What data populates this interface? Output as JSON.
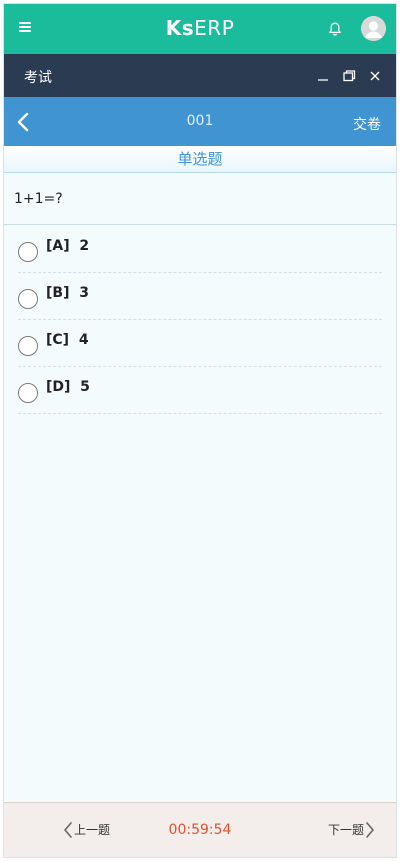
{
  "app": {
    "brand_prefix": "Ks",
    "brand_suffix": "ERP",
    "menu_icon": "hamburger-icon",
    "bell_icon": "bell-icon",
    "avatar_icon": "user-avatar-icon",
    "accent_color": "#1bbc9b"
  },
  "window": {
    "title": "考试",
    "controls": [
      "minimize-icon",
      "restore-icon",
      "close-icon"
    ],
    "bar_color": "#2b3c52"
  },
  "question_header": {
    "number": "001",
    "submit_label": "交卷",
    "back_icon": "chevron-left-icon",
    "bar_color": "#3f94d1"
  },
  "question": {
    "type": "单选题",
    "text": "1+1=?",
    "options": [
      {
        "letter": "[A]",
        "text": "2"
      },
      {
        "letter": "[B]",
        "text": "3"
      },
      {
        "letter": "[C]",
        "text": "4"
      },
      {
        "letter": "[D]",
        "text": "5"
      }
    ]
  },
  "footer": {
    "prev_label": "上一题",
    "next_label": "下一题",
    "timer": "00:59:54",
    "timer_color": "#e0522f"
  }
}
